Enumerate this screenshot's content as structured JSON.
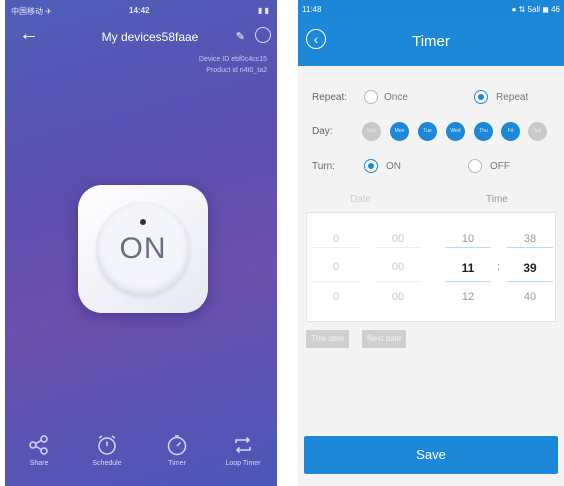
{
  "colors": {
    "accent": "#1e88d8",
    "left_bg": "#5b4fb0"
  },
  "left": {
    "status": {
      "carrier": "中国移动 ✈",
      "time": "14:42",
      "battery": "▮ ▮"
    },
    "title": "My devices58faae",
    "info_lines": [
      "Device ID ebf0c4cc15",
      "Product id n4t0_ta2"
    ],
    "power_label": "ON",
    "tabs": [
      {
        "label": "Share",
        "icon": "share-icon"
      },
      {
        "label": "Schedule",
        "icon": "alarm-clock-icon"
      },
      {
        "label": "Timer",
        "icon": "stopwatch-icon"
      },
      {
        "label": "Loop Timer",
        "icon": "loop-icon"
      }
    ]
  },
  "right": {
    "status": {
      "time": "11:48",
      "signal": "● ⇅ 5all ◼ 46"
    },
    "title": "Timer",
    "repeat": {
      "label": "Repeat:",
      "options": [
        "Once",
        "Repeat"
      ],
      "selected": "Repeat"
    },
    "day": {
      "label": "Day:",
      "days": [
        "Sun",
        "Mon",
        "Tue",
        "Wed",
        "Thu",
        "Fri",
        "Sat"
      ],
      "active": [
        false,
        true,
        true,
        true,
        true,
        true,
        false
      ]
    },
    "turn": {
      "label": "Turn:",
      "options": [
        "ON",
        "OFF"
      ],
      "selected": "ON"
    },
    "columns": {
      "date": "Date",
      "time": "Time"
    },
    "picker": {
      "date": {
        "col1": [
          "0",
          "0",
          "0"
        ],
        "col2": [
          "00",
          "00",
          "00"
        ]
      },
      "time": {
        "hours": [
          "10",
          "11",
          "12"
        ],
        "minutes": [
          "38",
          "39",
          "40"
        ]
      },
      "separator": ":"
    },
    "pills": [
      "This date",
      "Next date"
    ],
    "save_label": "Save"
  }
}
